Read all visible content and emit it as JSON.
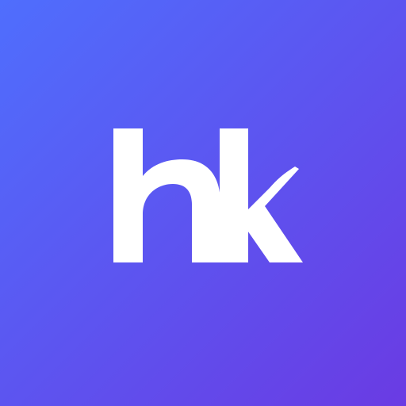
{
  "monogram": {
    "text": "hk"
  },
  "colors": {
    "gradient_start": "#4F6EFD",
    "gradient_end": "#6A3BE3",
    "letters": "#FFFFFF"
  }
}
